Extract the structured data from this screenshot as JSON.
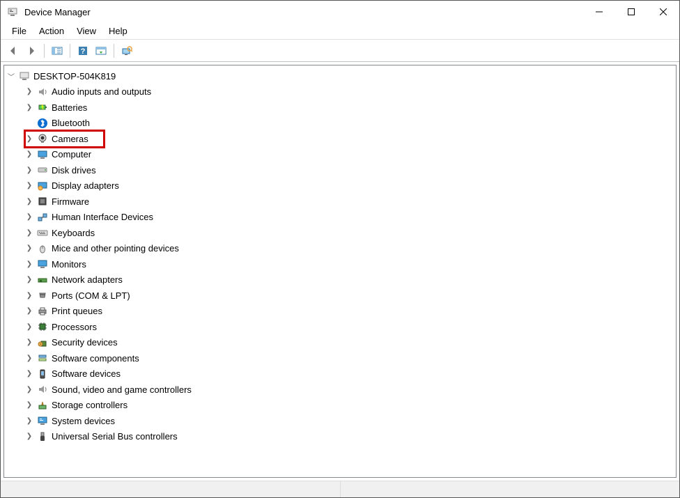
{
  "title": "Device Manager",
  "menu": {
    "file": "File",
    "action": "Action",
    "view": "View",
    "help": "Help"
  },
  "root": "DESKTOP-504K819",
  "highlighted_index": 3,
  "items": [
    {
      "label": "Audio inputs and outputs",
      "icon": "audio-icon"
    },
    {
      "label": "Batteries",
      "icon": "battery-icon"
    },
    {
      "label": "Bluetooth",
      "icon": "bluetooth-icon",
      "noChevron": true
    },
    {
      "label": "Cameras",
      "icon": "camera-icon"
    },
    {
      "label": "Computer",
      "icon": "computer-icon"
    },
    {
      "label": "Disk drives",
      "icon": "disk-icon"
    },
    {
      "label": "Display adapters",
      "icon": "display-icon"
    },
    {
      "label": "Firmware",
      "icon": "firmware-icon"
    },
    {
      "label": "Human Interface Devices",
      "icon": "hid-icon"
    },
    {
      "label": "Keyboards",
      "icon": "keyboard-icon"
    },
    {
      "label": "Mice and other pointing devices",
      "icon": "mouse-icon"
    },
    {
      "label": "Monitors",
      "icon": "monitor-icon"
    },
    {
      "label": "Network adapters",
      "icon": "network-icon"
    },
    {
      "label": "Ports (COM & LPT)",
      "icon": "ports-icon"
    },
    {
      "label": "Print queues",
      "icon": "print-icon"
    },
    {
      "label": "Processors",
      "icon": "processor-icon"
    },
    {
      "label": "Security devices",
      "icon": "security-icon"
    },
    {
      "label": "Software components",
      "icon": "softcomp-icon"
    },
    {
      "label": "Software devices",
      "icon": "softdev-icon"
    },
    {
      "label": "Sound, video and game controllers",
      "icon": "sound-icon"
    },
    {
      "label": "Storage controllers",
      "icon": "storage-icon"
    },
    {
      "label": "System devices",
      "icon": "system-icon"
    },
    {
      "label": "Universal Serial Bus controllers",
      "icon": "usb-icon"
    }
  ]
}
